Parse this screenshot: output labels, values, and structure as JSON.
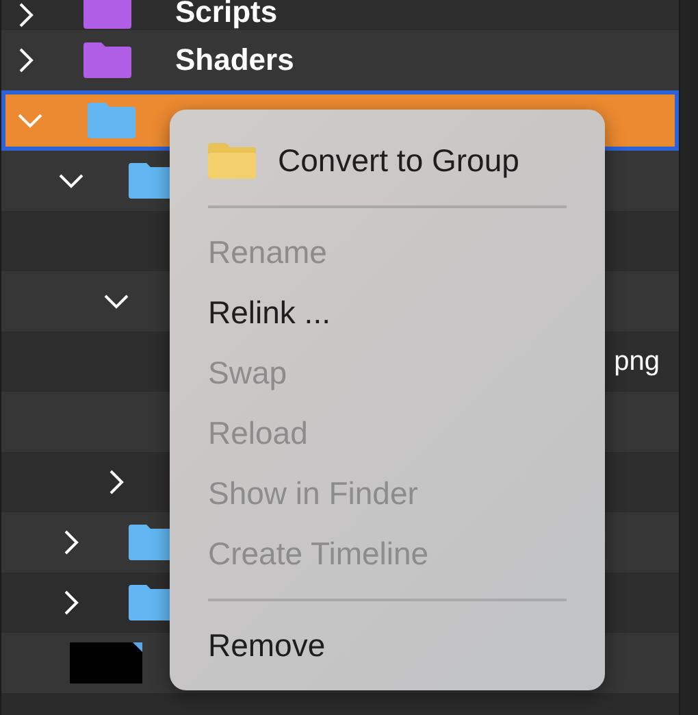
{
  "tree": [
    {
      "label": "Scripts",
      "kind": "folder",
      "color": "#b15ee6",
      "expanded": false,
      "selected": false
    },
    {
      "label": "Shaders",
      "kind": "folder",
      "color": "#b15ee6",
      "expanded": false,
      "selected": false
    },
    {
      "kind": "folder",
      "color": "#62b6f2",
      "expanded": true,
      "selected": true,
      "children": [
        {
          "kind": "folder",
          "color": "#62b6f2",
          "expanded": true,
          "selected": false,
          "children": [
            {
              "kind": "blank"
            },
            {
              "kind": "folder",
              "expanded": true,
              "selected": false,
              "children": [
                {
                  "kind": "text",
                  "label": "png"
                },
                {
                  "kind": "blank"
                }
              ]
            },
            {
              "kind": "folder",
              "expanded": false,
              "selected": false
            }
          ]
        },
        {
          "kind": "folder",
          "color": "#62b6f2",
          "expanded": false,
          "selected": false
        },
        {
          "kind": "folder",
          "color": "#62b6f2",
          "expanded": false,
          "selected": false
        }
      ]
    },
    {
      "kind": "image"
    }
  ],
  "context_menu": {
    "items": [
      {
        "kind": "icon_item",
        "label": "Convert to Group",
        "disabled": false
      },
      {
        "kind": "separator"
      },
      {
        "kind": "item",
        "label": "Rename",
        "disabled": true
      },
      {
        "kind": "item",
        "label": "Relink ...",
        "disabled": false
      },
      {
        "kind": "item",
        "label": "Swap",
        "disabled": true
      },
      {
        "kind": "item",
        "label": "Reload",
        "disabled": true
      },
      {
        "kind": "item",
        "label": "Show in Finder",
        "disabled": true
      },
      {
        "kind": "item",
        "label": "Create Timeline",
        "disabled": true
      },
      {
        "kind": "separator"
      },
      {
        "kind": "item",
        "label": "Remove",
        "disabled": false
      }
    ]
  }
}
